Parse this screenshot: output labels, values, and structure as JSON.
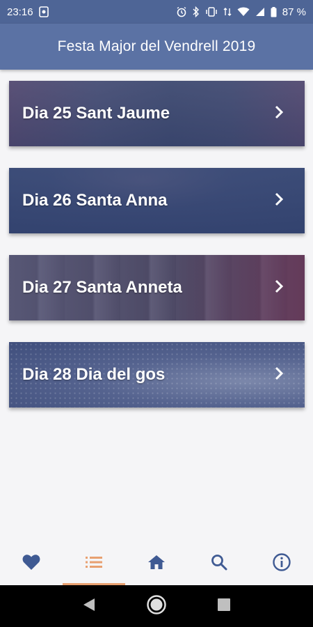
{
  "status_bar": {
    "time": "23:16",
    "battery_percent": "87 %"
  },
  "app_bar": {
    "title": "Festa Major del Vendrell 2019"
  },
  "days": [
    {
      "label": "Dia 25 Sant Jaume"
    },
    {
      "label": "Dia 26 Santa Anna"
    },
    {
      "label": "Dia 27 Santa Anneta"
    },
    {
      "label": "Dia 28 Dia del gos"
    }
  ],
  "bottom_nav": {
    "items": [
      {
        "icon": "heart-icon"
      },
      {
        "icon": "list-icon",
        "active": true
      },
      {
        "icon": "home-icon"
      },
      {
        "icon": "search-icon"
      },
      {
        "icon": "info-icon"
      }
    ],
    "icon_color": "#3f5a93",
    "active_color": "#e8a070"
  },
  "colors": {
    "status_bar": "#4e6596",
    "app_bar": "#5b72a4",
    "background": "#f5f5f7"
  }
}
